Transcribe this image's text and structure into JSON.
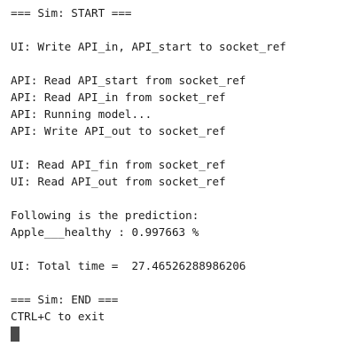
{
  "terminal": {
    "lines": [
      "=== Sim: START ===",
      "",
      "UI: Write API_in, API_start to socket_ref",
      "",
      "API: Read API_start from socket_ref",
      "API: Read API_in from socket_ref",
      "API: Running model...",
      "API: Write API_out to socket_ref",
      "",
      "UI: Read API_fin from socket_ref",
      "UI: Read API_out from socket_ref",
      "",
      "Following is the prediction:",
      "Apple___healthy : 0.997663 %",
      "",
      "UI: Total time =  27.46526288986206",
      "",
      "=== Sim: END ===",
      "CTRL+C to exit"
    ]
  },
  "colors": {
    "background": "#ffffff",
    "text": "#1c1c1c",
    "cursor": "#4a4a4a"
  }
}
